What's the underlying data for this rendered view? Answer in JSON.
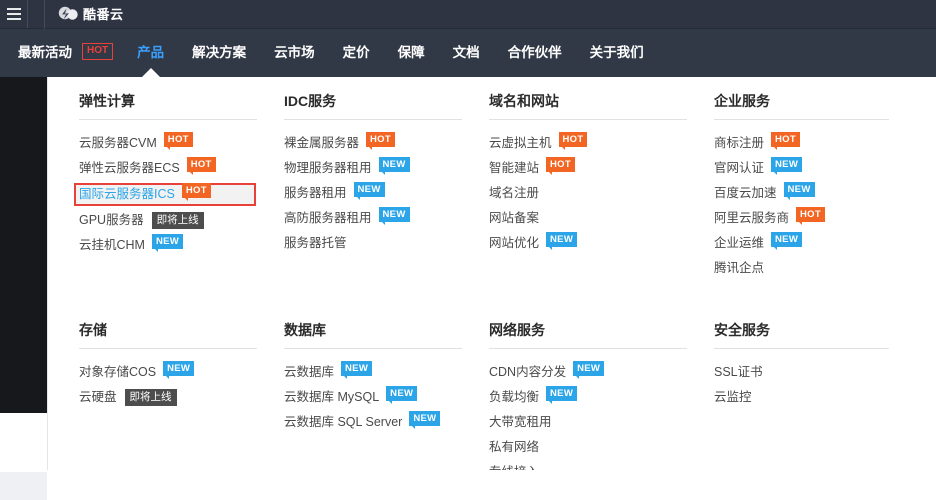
{
  "topbar": {
    "menu_icon": "hamburger-icon",
    "logo_icon": "cloud-logo-icon",
    "brand": "酷番云"
  },
  "nav": {
    "items": [
      {
        "label": "最新活动",
        "active": false,
        "badge": "HOT"
      },
      {
        "label": "产品",
        "active": true
      },
      {
        "label": "解决方案",
        "active": false
      },
      {
        "label": "云市场",
        "active": false
      },
      {
        "label": "定价",
        "active": false
      },
      {
        "label": "保障",
        "active": false
      },
      {
        "label": "文档",
        "active": false
      },
      {
        "label": "合作伙伴",
        "active": false
      },
      {
        "label": "关于我们",
        "active": false
      }
    ],
    "active_color": "#3aa0ff",
    "hot_color": "#e8413a"
  },
  "megamenu": {
    "columns": [
      {
        "title": "弹性计算",
        "items": [
          {
            "label": "云服务器CVM",
            "badge": "HOT",
            "badge_type": "hot"
          },
          {
            "label": "弹性云服务器ECS",
            "badge": "HOT",
            "badge_type": "hot"
          },
          {
            "label": "国际云服务器ICS",
            "badge": "HOT",
            "badge_type": "hot",
            "highlighted": true
          },
          {
            "label": "GPU服务器",
            "badge": "即将上线",
            "badge_type": "soon"
          },
          {
            "label": "云挂机CHM",
            "badge": "NEW",
            "badge_type": "new"
          }
        ]
      },
      {
        "title": "IDC服务",
        "items": [
          {
            "label": "裸金属服务器",
            "badge": "HOT",
            "badge_type": "hot"
          },
          {
            "label": "物理服务器租用",
            "badge": "NEW",
            "badge_type": "new"
          },
          {
            "label": "服务器租用",
            "badge": "NEW",
            "badge_type": "new"
          },
          {
            "label": "高防服务器租用",
            "badge": "NEW",
            "badge_type": "new"
          },
          {
            "label": "服务器托管",
            "badge": "",
            "badge_type": ""
          }
        ]
      },
      {
        "title": "域名和网站",
        "items": [
          {
            "label": "云虚拟主机",
            "badge": "HOT",
            "badge_type": "hot"
          },
          {
            "label": "智能建站",
            "badge": "HOT",
            "badge_type": "hot"
          },
          {
            "label": "域名注册",
            "badge": "",
            "badge_type": ""
          },
          {
            "label": "网站备案",
            "badge": "",
            "badge_type": ""
          },
          {
            "label": "网站优化",
            "badge": "NEW",
            "badge_type": "new"
          }
        ]
      },
      {
        "title": "企业服务",
        "items": [
          {
            "label": "商标注册",
            "badge": "HOT",
            "badge_type": "hot"
          },
          {
            "label": "官网认证",
            "badge": "NEW",
            "badge_type": "new"
          },
          {
            "label": "百度云加速",
            "badge": "NEW",
            "badge_type": "new"
          },
          {
            "label": "阿里云服务商",
            "badge": "HOT",
            "badge_type": "hot"
          },
          {
            "label": "企业运维",
            "badge": "NEW",
            "badge_type": "new"
          },
          {
            "label": "腾讯企点",
            "badge": "",
            "badge_type": ""
          }
        ]
      },
      {
        "title": "存储",
        "items": [
          {
            "label": "对象存储COS",
            "badge": "NEW",
            "badge_type": "new"
          },
          {
            "label": "云硬盘",
            "badge": "即将上线",
            "badge_type": "soon"
          }
        ]
      },
      {
        "title": "数据库",
        "items": [
          {
            "label": "云数据库",
            "badge": "NEW",
            "badge_type": "new"
          },
          {
            "label": "云数据库 MySQL",
            "badge": "NEW",
            "badge_type": "new"
          },
          {
            "label": "云数据库 SQL Server",
            "badge": "NEW",
            "badge_type": "new"
          }
        ]
      },
      {
        "title": "网络服务",
        "items": [
          {
            "label": "CDN内容分发",
            "badge": "NEW",
            "badge_type": "new"
          },
          {
            "label": "负载均衡",
            "badge": "NEW",
            "badge_type": "new"
          },
          {
            "label": "大带宽租用",
            "badge": "",
            "badge_type": ""
          },
          {
            "label": "私有网络",
            "badge": "",
            "badge_type": ""
          },
          {
            "label": "专线接入",
            "badge": "",
            "badge_type": ""
          }
        ]
      },
      {
        "title": "安全服务",
        "items": [
          {
            "label": "SSL证书",
            "badge": "",
            "badge_type": ""
          },
          {
            "label": "云监控",
            "badge": "",
            "badge_type": ""
          }
        ]
      }
    ]
  },
  "colors": {
    "topbar_bg": "#2e3442",
    "nav_bg": "#313846",
    "sidebar_bg": "#17181c",
    "hot_badge": "#f26522",
    "new_badge": "#2ba5e8",
    "soon_badge": "#4d4d4d",
    "highlight_border": "#e8413a",
    "link_blue": "#2ba5e8"
  }
}
